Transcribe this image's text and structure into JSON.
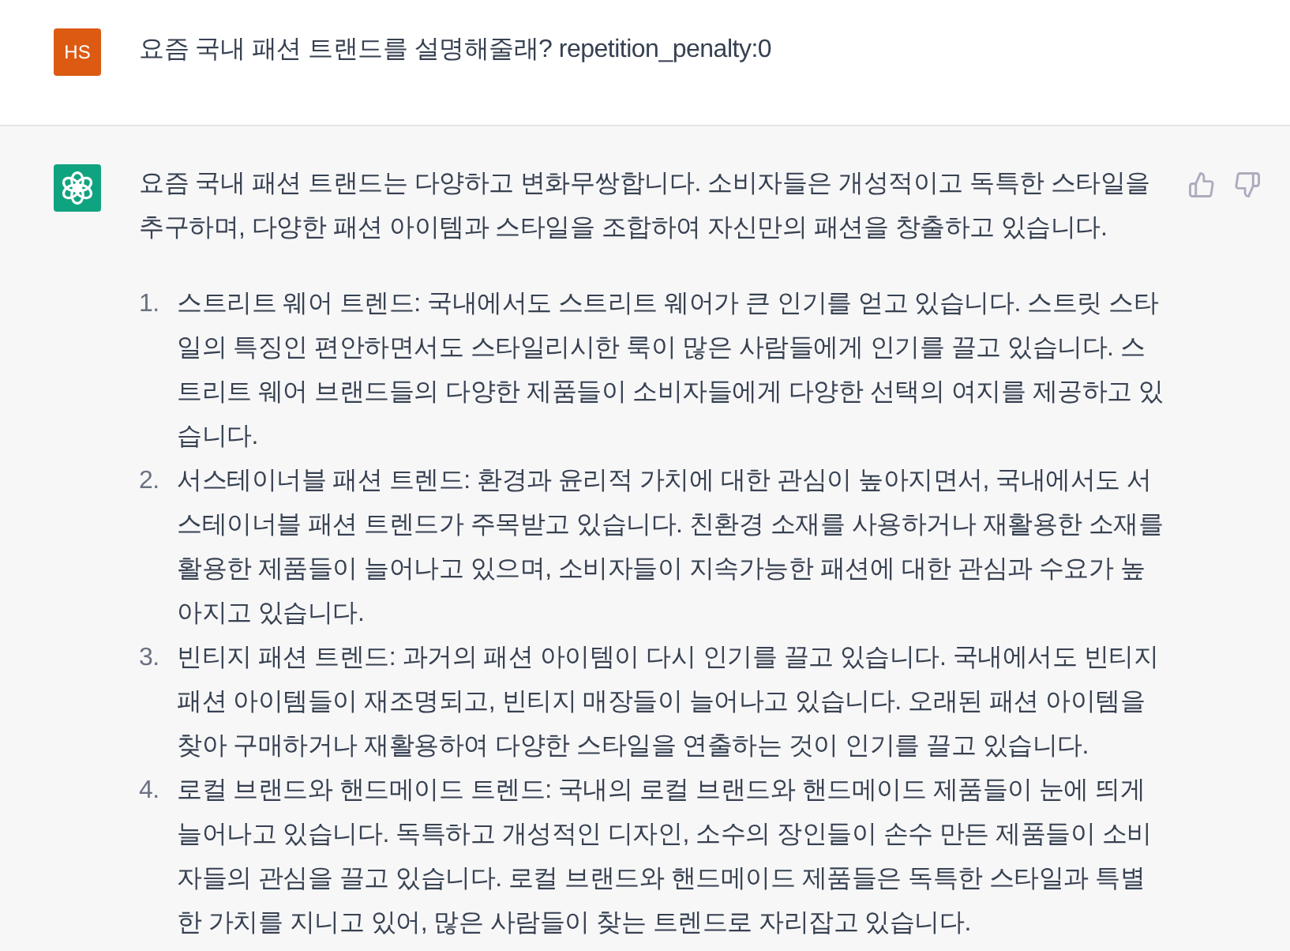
{
  "user_message": {
    "avatar_initials": "HS",
    "text": "요즘 국내 패션 트랜드를 설명해줄래? repetition_penalty:0"
  },
  "assistant_message": {
    "intro": "요즘 국내 패션 트랜드는 다양하고 변화무쌍합니다. 소비자들은 개성적이고 독특한 스타일을 추구하며, 다양한 패션 아이템과 스타일을 조합하여 자신만의 패션을 창출하고 있습니다.",
    "items": [
      {
        "number": "1.",
        "text": "스트리트 웨어 트렌드: 국내에서도 스트리트 웨어가 큰 인기를 얻고 있습니다. 스트릿 스타일의 특징인 편안하면서도 스타일리시한 룩이 많은 사람들에게 인기를 끌고 있습니다. 스트리트 웨어 브랜드들의 다양한 제품들이 소비자들에게 다양한 선택의 여지를 제공하고 있습니다."
      },
      {
        "number": "2.",
        "text": "서스테이너블 패션 트렌드: 환경과 윤리적 가치에 대한 관심이 높아지면서, 국내에서도 서스테이너블 패션 트렌드가 주목받고 있습니다. 친환경 소재를 사용하거나 재활용한 소재를 활용한 제품들이 늘어나고 있으며, 소비자들이 지속가능한 패션에 대한 관심과 수요가 높아지고 있습니다."
      },
      {
        "number": "3.",
        "text": "빈티지 패션 트렌드: 과거의 패션 아이템이 다시 인기를 끌고 있습니다. 국내에서도 빈티지 패션 아이템들이 재조명되고, 빈티지 매장들이 늘어나고 있습니다. 오래된 패션 아이템을 찾아 구매하거나 재활용하여 다양한 스타일을 연출하는 것이 인기를 끌고 있습니다."
      },
      {
        "number": "4.",
        "text": "로컬 브랜드와 핸드메이드 트렌드: 국내의 로컬 브랜드와 핸드메이드 제품들이 눈에 띄게 늘어나고 있습니다. 독특하고 개성적인 디자인, 소수의 장인들이 손수 만든 제품들이 소비자들의 관심을 끌고 있습니다. 로컬 브랜드와 핸드메이드 제품들은 독특한 스타일과 특별한 가치를 지니고 있어, 많은 사람들이 찾는 트렌드로 자리잡고 있습니다."
      }
    ]
  }
}
